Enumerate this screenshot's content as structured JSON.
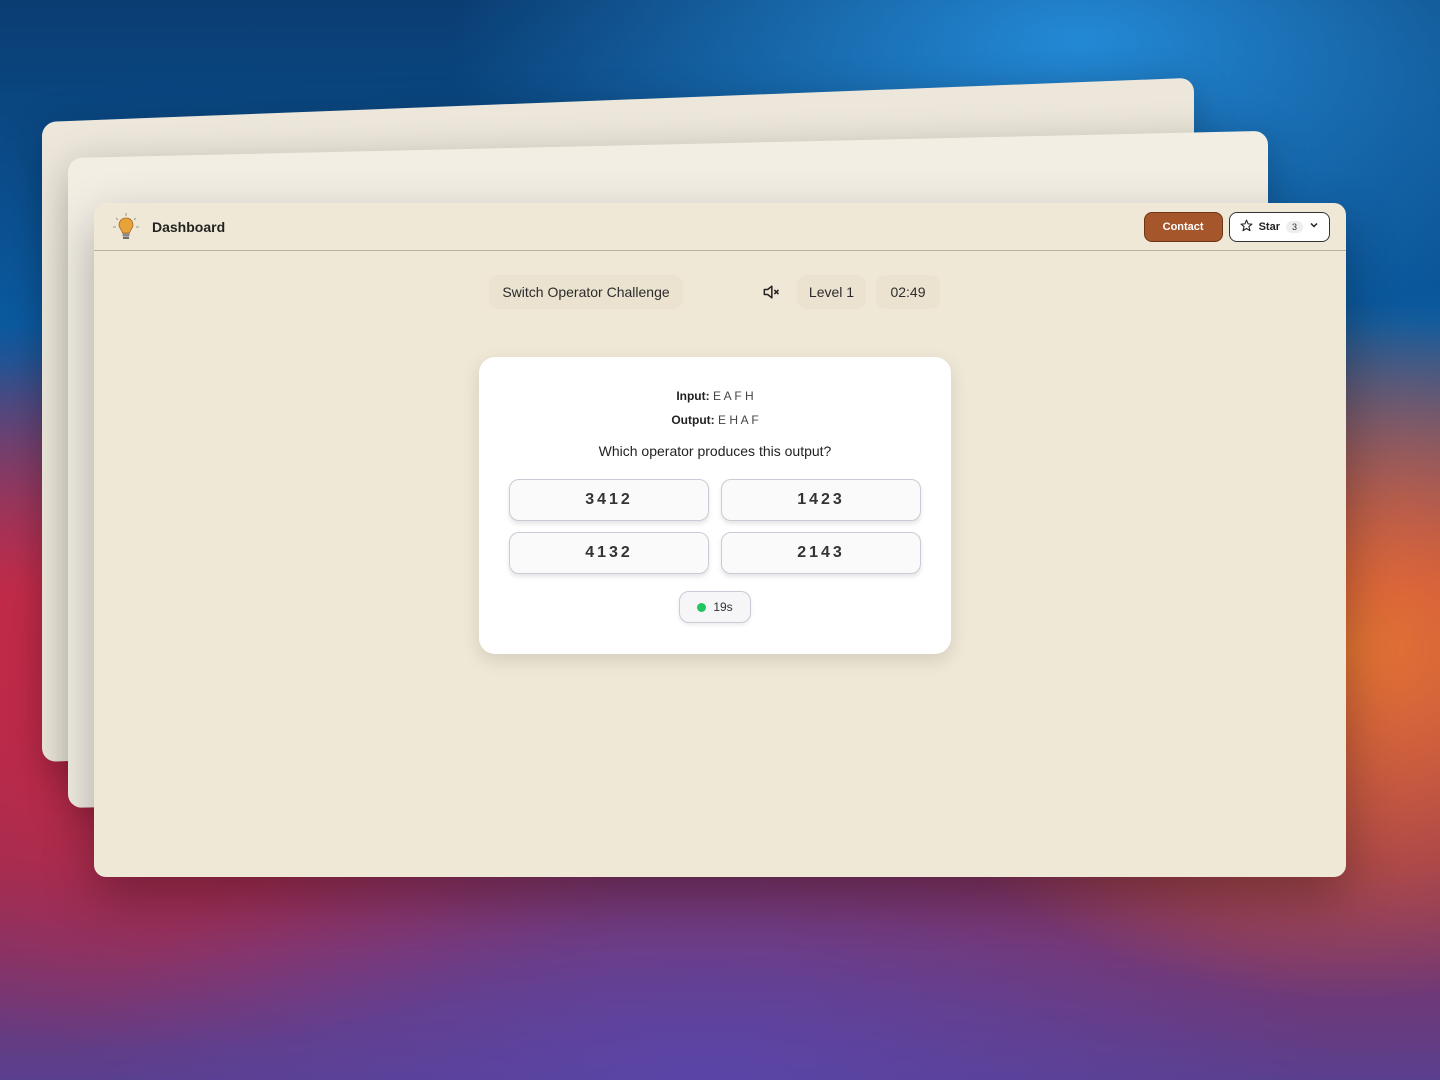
{
  "header": {
    "brand": "Dashboard",
    "contact_label": "Contact",
    "star_label": "Star",
    "star_count": "3"
  },
  "game": {
    "title": "Switch Operator Challenge",
    "level": "Level 1",
    "timer": "02:49",
    "sound": "muted"
  },
  "question": {
    "input_label": "Input:",
    "input_value": "E A F H",
    "output_label": "Output:",
    "output_value": "E H A F",
    "prompt": "Which operator produces this output?",
    "options": [
      "3412",
      "1423",
      "4132",
      "2143"
    ],
    "countdown": "19s"
  },
  "icons": {
    "logo": "lightbulb-icon",
    "mute": "speaker-muted-icon",
    "star": "star-icon",
    "chevron": "chevron-down-icon"
  },
  "colors": {
    "contact": "#a5562b",
    "countdown_dot": "#22c55e",
    "lightbulb": "#e8a23a"
  }
}
